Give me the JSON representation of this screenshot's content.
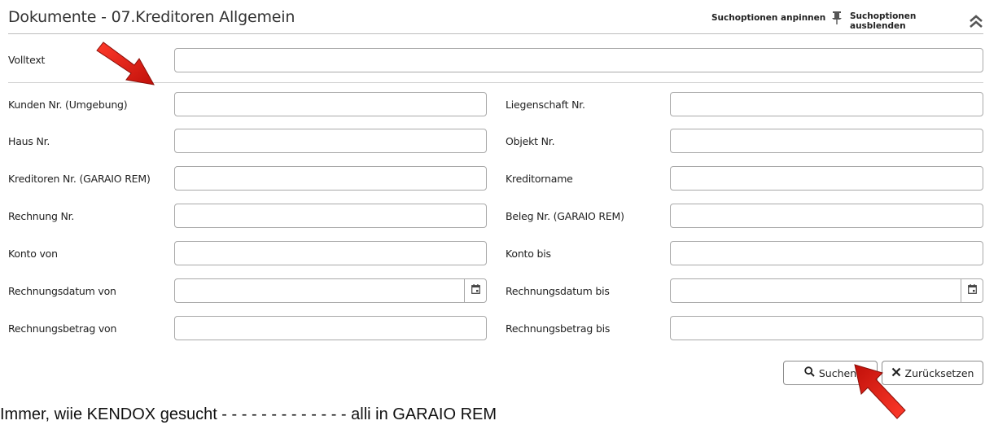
{
  "header": {
    "title": "Dokumente - 07.Kreditoren Allgemein",
    "pin_label": "Suchoptionen anpinnen",
    "hide_label": "Suchoptionen ausblenden"
  },
  "volltext": {
    "label": "Volltext",
    "value": ""
  },
  "fields_left": [
    {
      "label": "Kunden Nr. (Umgebung)",
      "value": ""
    },
    {
      "label": "Haus Nr.",
      "value": ""
    },
    {
      "label": "Kreditoren Nr. (GARAIO REM)",
      "value": ""
    },
    {
      "label": "Rechnung Nr.",
      "value": ""
    },
    {
      "label": "Konto von",
      "value": ""
    },
    {
      "label": "Rechnungsdatum von",
      "value": ""
    },
    {
      "label": "Rechnungsbetrag von",
      "value": ""
    }
  ],
  "fields_right": [
    {
      "label": "Liegenschaft Nr.",
      "value": ""
    },
    {
      "label": "Objekt Nr.",
      "value": ""
    },
    {
      "label": "Kreditorname",
      "value": ""
    },
    {
      "label": "Beleg Nr. (GARAIO REM)",
      "value": ""
    },
    {
      "label": "Konto bis",
      "value": ""
    },
    {
      "label": "Rechnungsdatum bis",
      "value": ""
    },
    {
      "label": "Rechnungsbetrag bis",
      "value": ""
    }
  ],
  "buttons": {
    "search_label": "Suchen",
    "reset_label": "Zurücksetzen"
  },
  "footer_text": "Immer, wiie KENDOX gesucht - - - - - - - - - - - - - alli in GARAIO REM",
  "colors": {
    "annotation_arrow": "#e0140e",
    "border": "#a9a9a9"
  }
}
